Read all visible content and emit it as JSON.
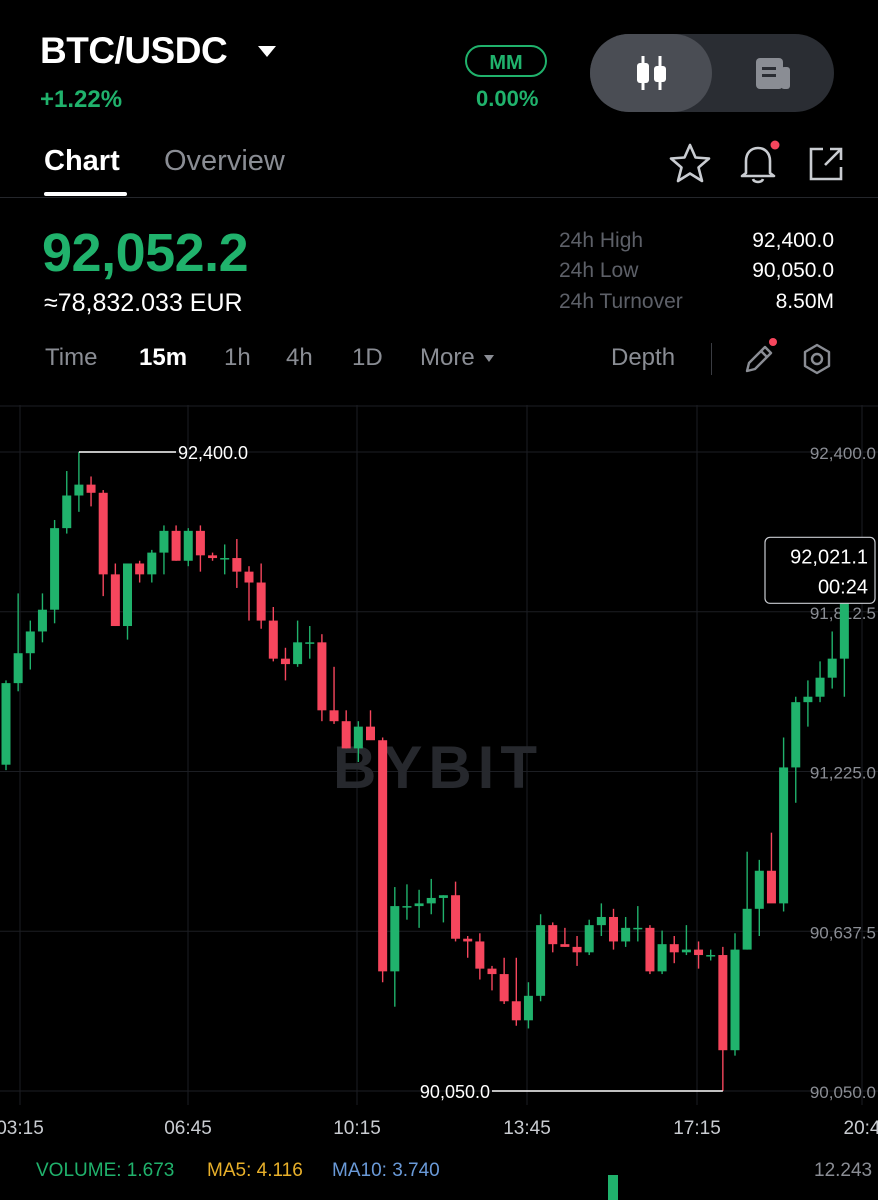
{
  "header": {
    "pair": "BTC/USDC",
    "change_pct": "+1.22%",
    "mm_label": "MM",
    "mm_value": "0.00%"
  },
  "tabs": [
    {
      "label": "Chart",
      "active": true
    },
    {
      "label": "Overview",
      "active": false
    }
  ],
  "ticker": {
    "last_price": "92,052.2",
    "fiat_equiv": "≈78,832.033 EUR",
    "stats": [
      {
        "label": "24h High",
        "value": "92,400.0"
      },
      {
        "label": "24h Low",
        "value": "90,050.0"
      },
      {
        "label": "24h Turnover",
        "value": "8.50M"
      }
    ]
  },
  "timeframes": {
    "items": [
      "Time",
      "15m",
      "1h",
      "4h",
      "1D"
    ],
    "active": "15m",
    "more_label": "More",
    "depth_label": "Depth"
  },
  "colors": {
    "up": "#20b26c",
    "down": "#f6465d",
    "grid": "#1c1e23",
    "axis_text": "#8a8d94"
  },
  "icons": [
    "caret-down-icon",
    "candlestick-icon",
    "news-icon",
    "star-icon",
    "bell-icon",
    "share-icon",
    "pencil-icon",
    "settings-hex-icon"
  ],
  "chart_data": {
    "type": "candlestick",
    "interval": "15m",
    "watermark": "BYBIT",
    "y_ticks": [
      "92,400.0",
      "91,812.5",
      "91,225.0",
      "90,637.5",
      "90,050.0"
    ],
    "y_tick_values": [
      92400.0,
      91812.5,
      91225.0,
      90637.5,
      90050.0
    ],
    "ylim": [
      90050.0,
      92400.0
    ],
    "x_ticks": [
      "03:15",
      "06:45",
      "10:15",
      "13:45",
      "17:15",
      "20:4"
    ],
    "high_marker": "92,400.0",
    "low_marker": "90,050.0",
    "current_price_label": "92,021.1",
    "countdown_label": "00:24",
    "candles": [
      {
        "o": 91250,
        "h": 91560,
        "l": 91230,
        "c": 91550
      },
      {
        "o": 91550,
        "h": 91880,
        "l": 91520,
        "c": 91660
      },
      {
        "o": 91660,
        "h": 91780,
        "l": 91600,
        "c": 91740
      },
      {
        "o": 91740,
        "h": 91880,
        "l": 91700,
        "c": 91820
      },
      {
        "o": 91820,
        "h": 92150,
        "l": 91770,
        "c": 92120
      },
      {
        "o": 92120,
        "h": 92330,
        "l": 92100,
        "c": 92240
      },
      {
        "o": 92240,
        "h": 92400,
        "l": 92180,
        "c": 92280
      },
      {
        "o": 92280,
        "h": 92310,
        "l": 92200,
        "c": 92250
      },
      {
        "o": 92250,
        "h": 92260,
        "l": 91870,
        "c": 91950
      },
      {
        "o": 91950,
        "h": 91990,
        "l": 91760,
        "c": 91760
      },
      {
        "o": 91760,
        "h": 91950,
        "l": 91710,
        "c": 91990
      },
      {
        "o": 91990,
        "h": 92000,
        "l": 91920,
        "c": 91950
      },
      {
        "o": 91950,
        "h": 92040,
        "l": 91920,
        "c": 92030
      },
      {
        "o": 92030,
        "h": 92130,
        "l": 91950,
        "c": 92110
      },
      {
        "o": 92110,
        "h": 92130,
        "l": 92000,
        "c": 92000
      },
      {
        "o": 92000,
        "h": 92120,
        "l": 91980,
        "c": 92110
      },
      {
        "o": 92110,
        "h": 92130,
        "l": 91960,
        "c": 92020
      },
      {
        "o": 92020,
        "h": 92030,
        "l": 92000,
        "c": 92010
      },
      {
        "o": 92010,
        "h": 92060,
        "l": 91950,
        "c": 92010
      },
      {
        "o": 92010,
        "h": 92080,
        "l": 91900,
        "c": 91960
      },
      {
        "o": 91960,
        "h": 91980,
        "l": 91780,
        "c": 91920
      },
      {
        "o": 91920,
        "h": 91990,
        "l": 91750,
        "c": 91780
      },
      {
        "o": 91780,
        "h": 91830,
        "l": 91630,
        "c": 91640
      },
      {
        "o": 91640,
        "h": 91680,
        "l": 91560,
        "c": 91620
      },
      {
        "o": 91620,
        "h": 91780,
        "l": 91610,
        "c": 91700
      },
      {
        "o": 91700,
        "h": 91760,
        "l": 91640,
        "c": 91700
      },
      {
        "o": 91700,
        "h": 91730,
        "l": 91410,
        "c": 91450
      },
      {
        "o": 91450,
        "h": 91610,
        "l": 91400,
        "c": 91410
      },
      {
        "o": 91410,
        "h": 91450,
        "l": 91310,
        "c": 91310
      },
      {
        "o": 91310,
        "h": 91410,
        "l": 91260,
        "c": 91390
      },
      {
        "o": 91390,
        "h": 91450,
        "l": 91350,
        "c": 91340
      },
      {
        "o": 91340,
        "h": 91350,
        "l": 90450,
        "c": 90490
      },
      {
        "o": 90490,
        "h": 90800,
        "l": 90360,
        "c": 90730
      },
      {
        "o": 90730,
        "h": 90810,
        "l": 90680,
        "c": 90730
      },
      {
        "o": 90730,
        "h": 90790,
        "l": 90650,
        "c": 90740
      },
      {
        "o": 90740,
        "h": 90830,
        "l": 90700,
        "c": 90760
      },
      {
        "o": 90760,
        "h": 90770,
        "l": 90670,
        "c": 90770
      },
      {
        "o": 90770,
        "h": 90820,
        "l": 90600,
        "c": 90610
      },
      {
        "o": 90610,
        "h": 90620,
        "l": 90540,
        "c": 90600
      },
      {
        "o": 90600,
        "h": 90630,
        "l": 90460,
        "c": 90500
      },
      {
        "o": 90500,
        "h": 90510,
        "l": 90420,
        "c": 90480
      },
      {
        "o": 90480,
        "h": 90540,
        "l": 90370,
        "c": 90380
      },
      {
        "o": 90380,
        "h": 90540,
        "l": 90290,
        "c": 90310
      },
      {
        "o": 90310,
        "h": 90450,
        "l": 90280,
        "c": 90400
      },
      {
        "o": 90400,
        "h": 90700,
        "l": 90380,
        "c": 90660
      },
      {
        "o": 90660,
        "h": 90670,
        "l": 90560,
        "c": 90590
      },
      {
        "o": 90590,
        "h": 90650,
        "l": 90580,
        "c": 90580
      },
      {
        "o": 90580,
        "h": 90620,
        "l": 90510,
        "c": 90560
      },
      {
        "o": 90560,
        "h": 90680,
        "l": 90550,
        "c": 90660
      },
      {
        "o": 90660,
        "h": 90740,
        "l": 90620,
        "c": 90690
      },
      {
        "o": 90690,
        "h": 90720,
        "l": 90570,
        "c": 90600
      },
      {
        "o": 90600,
        "h": 90690,
        "l": 90580,
        "c": 90650
      },
      {
        "o": 90650,
        "h": 90730,
        "l": 90600,
        "c": 90650
      },
      {
        "o": 90650,
        "h": 90660,
        "l": 90480,
        "c": 90490
      },
      {
        "o": 90490,
        "h": 90640,
        "l": 90480,
        "c": 90590
      },
      {
        "o": 90590,
        "h": 90620,
        "l": 90520,
        "c": 90560
      },
      {
        "o": 90560,
        "h": 90660,
        "l": 90550,
        "c": 90570
      },
      {
        "o": 90570,
        "h": 90600,
        "l": 90500,
        "c": 90550
      },
      {
        "o": 90550,
        "h": 90570,
        "l": 90530,
        "c": 90550
      },
      {
        "o": 90550,
        "h": 90580,
        "l": 90050,
        "c": 90200
      },
      {
        "o": 90200,
        "h": 90630,
        "l": 90180,
        "c": 90570
      },
      {
        "o": 90570,
        "h": 90930,
        "l": 90570,
        "c": 90720
      },
      {
        "o": 90720,
        "h": 90900,
        "l": 90620,
        "c": 90860
      },
      {
        "o": 90860,
        "h": 91000,
        "l": 90820,
        "c": 90740
      },
      {
        "o": 90740,
        "h": 91350,
        "l": 90710,
        "c": 91240
      },
      {
        "o": 91240,
        "h": 91500,
        "l": 91110,
        "c": 91480
      },
      {
        "o": 91480,
        "h": 91560,
        "l": 91390,
        "c": 91500
      },
      {
        "o": 91500,
        "h": 91630,
        "l": 91480,
        "c": 91570
      },
      {
        "o": 91570,
        "h": 91740,
        "l": 91530,
        "c": 91640
      },
      {
        "o": 91640,
        "h": 92060,
        "l": 91500,
        "c": 92020
      }
    ],
    "volume_label": "VOLUME: 1.673",
    "ma5_label": "MA5: 4.116",
    "ma10_label": "MA10: 3.740",
    "volume_axis_label": "12.243"
  }
}
